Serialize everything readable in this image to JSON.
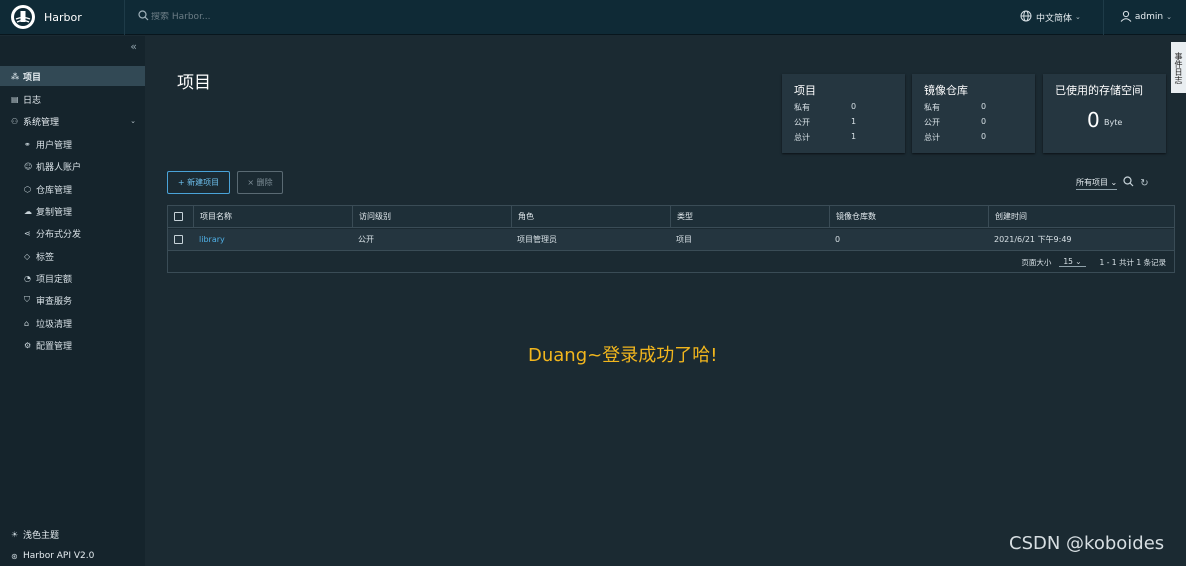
{
  "header": {
    "brand": "Harbor",
    "search_placeholder": "搜索 Harbor...",
    "language": "中文简体",
    "user": "admin"
  },
  "sidebar": {
    "items": [
      {
        "label": "项目",
        "icon": "projects-icon"
      },
      {
        "label": "日志",
        "icon": "logs-icon"
      },
      {
        "label": "系统管理",
        "icon": "admin-icon"
      }
    ],
    "sub_items": [
      {
        "label": "用户管理",
        "icon": "users-icon"
      },
      {
        "label": "机器人账户",
        "icon": "robot-icon"
      },
      {
        "label": "仓库管理",
        "icon": "registry-icon"
      },
      {
        "label": "复制管理",
        "icon": "replication-icon"
      },
      {
        "label": "分布式分发",
        "icon": "distribution-icon"
      },
      {
        "label": "标签",
        "icon": "tag-icon"
      },
      {
        "label": "项目定额",
        "icon": "quota-icon"
      },
      {
        "label": "审查服务",
        "icon": "shield-icon"
      },
      {
        "label": "垃圾清理",
        "icon": "trash-icon"
      },
      {
        "label": "配置管理",
        "icon": "gear-icon"
      }
    ],
    "footer": [
      {
        "label": "浅色主题",
        "icon": "sun-icon"
      },
      {
        "label": "Harbor API V2.0",
        "icon": "api-icon"
      }
    ]
  },
  "main": {
    "title": "项目",
    "cards": {
      "projects": {
        "title": "项目",
        "rows": [
          {
            "label": "私有",
            "value": "0"
          },
          {
            "label": "公开",
            "value": "1"
          },
          {
            "label": "总计",
            "value": "1"
          }
        ]
      },
      "repos": {
        "title": "镜像仓库",
        "rows": [
          {
            "label": "私有",
            "value": "0"
          },
          {
            "label": "公开",
            "value": "0"
          },
          {
            "label": "总计",
            "value": "0"
          }
        ]
      },
      "storage": {
        "title": "已使用的存储空间",
        "value": "0",
        "unit": "Byte"
      }
    },
    "new_project_label": "+ 新建项目",
    "delete_label": "× 删除",
    "filter_label": "所有项目",
    "table": {
      "headers": [
        "项目名称",
        "访问级别",
        "角色",
        "类型",
        "镜像仓库数",
        "创建时间"
      ],
      "rows": [
        [
          "library",
          "公开",
          "项目管理员",
          "项目",
          "0",
          "2021/6/21 下午9:49"
        ]
      ],
      "page_size_label": "页面大小",
      "page_size": "15",
      "total_label": "1 - 1 共计 1 条记录"
    },
    "message": "Duang~登录成功了哈!"
  },
  "side_tab": "事件日志",
  "watermark": "CSDN @koboides"
}
